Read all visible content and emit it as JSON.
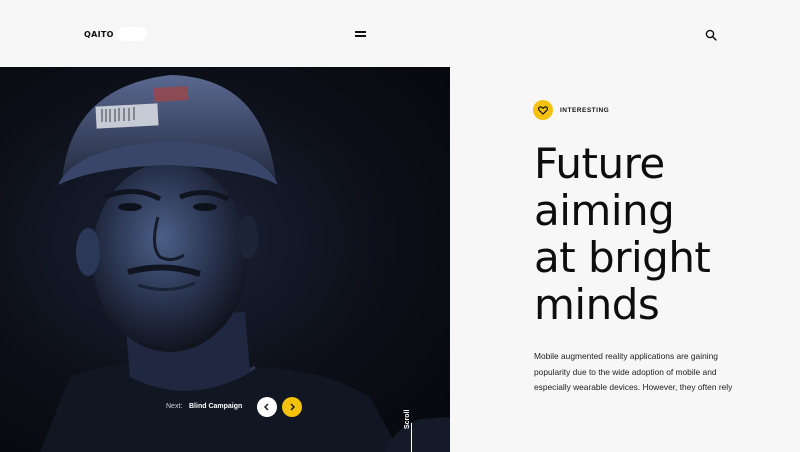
{
  "header": {
    "logo_text": "QAITO",
    "menu_icon": "hamburger-icon",
    "search_icon": "search-icon"
  },
  "hero": {
    "next_label": "Next:",
    "next_title": "Blind Campaign",
    "prev_icon": "chevron-left-icon",
    "next_icon": "chevron-right-icon",
    "scroll_label": "Scroll"
  },
  "article": {
    "tag_icon": "heart-icon",
    "tag_label": "INTERESTING",
    "headline_lines": [
      "Future",
      "aiming",
      "at bright",
      "minds"
    ],
    "body": "Mobile augmented reality applications are gaining popularity due to the wide adoption of mobile and especially wearable devices. However, they often rely"
  },
  "colors": {
    "accent": "#f4c20d",
    "background": "#f7f7f7",
    "text": "#111111"
  }
}
